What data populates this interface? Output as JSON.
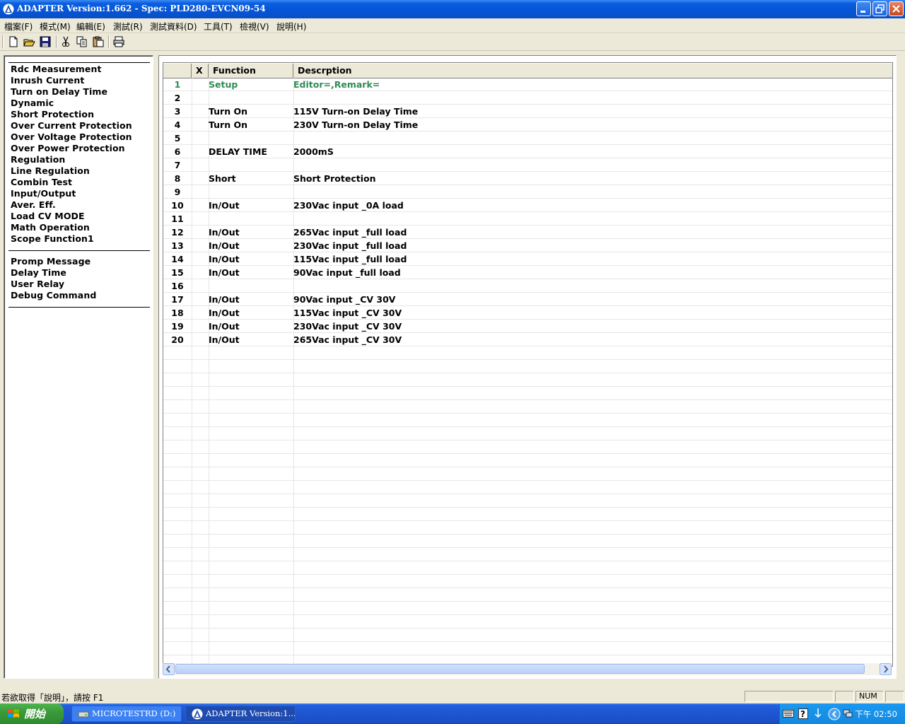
{
  "window": {
    "title": "ADAPTER Version:1.662 - Spec: PLD280-EVCN09-54"
  },
  "menu": [
    "檔案(F)",
    "模式(M)",
    "編輯(E)",
    "測試(R)",
    "測試資料(D)",
    "工具(T)",
    "檢視(V)",
    "說明(H)"
  ],
  "toolbar": [
    "new-icon",
    "open-icon",
    "save-icon",
    "cut-icon",
    "copy-icon",
    "paste-icon",
    "print-icon"
  ],
  "left_panel": {
    "group1": [
      "Rdc Measurement",
      "Inrush Current",
      "Turn on Delay Time",
      "Dynamic",
      "Short Protection",
      "Over Current Protection",
      "Over Voltage Protection",
      "Over Power Protection",
      "Regulation",
      "Line Regulation",
      "Combin Test",
      "Input/Output",
      "Aver. Eff.",
      "Load CV MODE",
      "Math Operation",
      "Scope Function1"
    ],
    "group2": [
      "Promp Message",
      "Delay Time",
      "User Relay",
      "Debug Command"
    ]
  },
  "grid": {
    "headers": {
      "x": "X",
      "function": "Function",
      "description": "Descrption"
    },
    "rows": [
      {
        "n": "1",
        "fn": "Setup",
        "desc": "Editor=,Remark="
      },
      {
        "n": "2",
        "fn": "",
        "desc": ""
      },
      {
        "n": "3",
        "fn": "Turn On",
        "desc": "115V Turn-on Delay Time"
      },
      {
        "n": "4",
        "fn": "Turn On",
        "desc": "230V Turn-on Delay Time"
      },
      {
        "n": "5",
        "fn": "",
        "desc": ""
      },
      {
        "n": "6",
        "fn": "DELAY TIME",
        "desc": "2000mS"
      },
      {
        "n": "7",
        "fn": "",
        "desc": ""
      },
      {
        "n": "8",
        "fn": "Short",
        "desc": "Short Protection"
      },
      {
        "n": "9",
        "fn": "",
        "desc": ""
      },
      {
        "n": "10",
        "fn": "In/Out",
        "desc": "230Vac input _0A load"
      },
      {
        "n": "11",
        "fn": "",
        "desc": ""
      },
      {
        "n": "12",
        "fn": "In/Out",
        "desc": "265Vac input _full load"
      },
      {
        "n": "13",
        "fn": "In/Out",
        "desc": "230Vac input _full load"
      },
      {
        "n": "14",
        "fn": "In/Out",
        "desc": "115Vac input _full load"
      },
      {
        "n": "15",
        "fn": "In/Out",
        "desc": "90Vac input _full load"
      },
      {
        "n": "16",
        "fn": "",
        "desc": ""
      },
      {
        "n": "17",
        "fn": "In/Out",
        "desc": "90Vac input _CV 30V"
      },
      {
        "n": "18",
        "fn": "In/Out",
        "desc": "115Vac input _CV 30V"
      },
      {
        "n": "19",
        "fn": "In/Out",
        "desc": "230Vac input _CV 30V"
      },
      {
        "n": "20",
        "fn": "In/Out",
        "desc": "265Vac input _CV 30V"
      }
    ],
    "highlight_color": "#2e8b57"
  },
  "status": {
    "message": "若欲取得「說明」，請按 F1",
    "num": "NUM"
  },
  "taskbar": {
    "start": "開始",
    "items": [
      "MICROTESTRD (D:)",
      "ADAPTER Version:1...."
    ],
    "clock": "下午 02:50"
  }
}
